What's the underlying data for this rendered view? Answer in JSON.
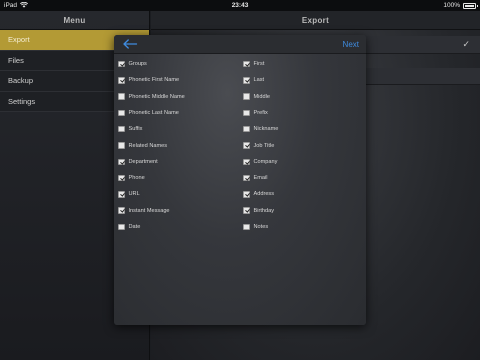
{
  "status_bar": {
    "device": "iPad",
    "time": "23:43",
    "battery": "100%"
  },
  "sidebar": {
    "title": "Menu",
    "items": [
      {
        "label": "Export",
        "active": true
      },
      {
        "label": "Files",
        "active": false
      },
      {
        "label": "Backup",
        "active": false
      },
      {
        "label": "Settings",
        "active": false
      }
    ]
  },
  "main": {
    "title": "Export"
  },
  "dialog": {
    "next_label": "Next",
    "left_options": [
      {
        "label": "Groups",
        "checked": true
      },
      {
        "label": "Phonetic First Name",
        "checked": true
      },
      {
        "label": "Phonetic Middle Name",
        "checked": false
      },
      {
        "label": "Phonetic Last Name",
        "checked": false
      },
      {
        "label": "Suffix",
        "checked": false
      },
      {
        "label": "Related Names",
        "checked": false
      },
      {
        "label": "Department",
        "checked": true
      },
      {
        "label": "Phone",
        "checked": true
      },
      {
        "label": "URL",
        "checked": true
      },
      {
        "label": "Instant Message",
        "checked": true
      },
      {
        "label": "Date",
        "checked": false
      }
    ],
    "right_options": [
      {
        "label": "First",
        "checked": true
      },
      {
        "label": "Last",
        "checked": true
      },
      {
        "label": "Middle",
        "checked": false
      },
      {
        "label": "Prefix",
        "checked": false
      },
      {
        "label": "Nickname",
        "checked": false
      },
      {
        "label": "Job Title",
        "checked": true
      },
      {
        "label": "Company",
        "checked": true
      },
      {
        "label": "Email",
        "checked": true
      },
      {
        "label": "Address",
        "checked": true
      },
      {
        "label": "Birthday",
        "checked": true
      },
      {
        "label": "Notes",
        "checked": false
      }
    ]
  }
}
